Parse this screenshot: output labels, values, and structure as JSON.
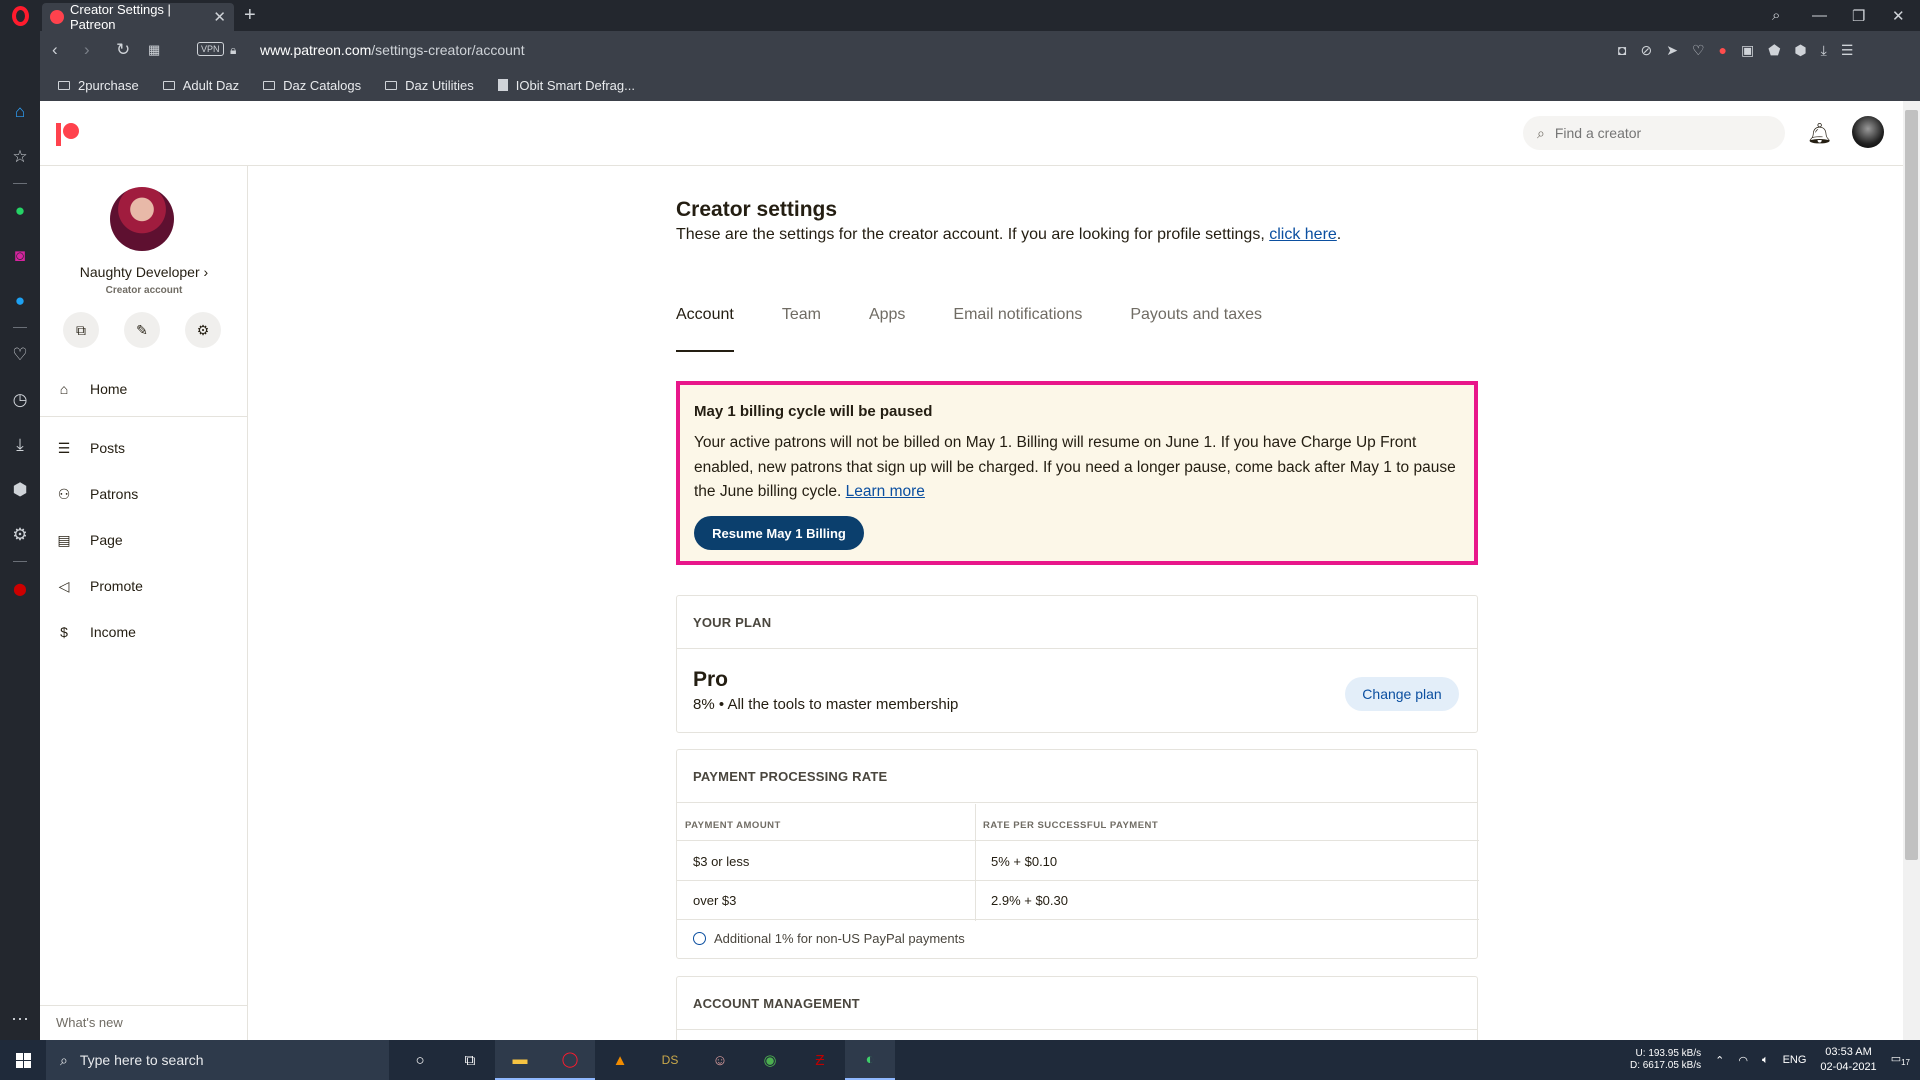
{
  "browser": {
    "tab_title": "Creator Settings | Patreon",
    "url_domain": "www.patreon.com",
    "url_path": "/settings-creator/account",
    "vpn_label": "VPN",
    "bookmarks": [
      "2purchase",
      "Adult Daz",
      "Daz Catalogs",
      "Daz Utilities",
      "IObit Smart Defrag..."
    ]
  },
  "header": {
    "search_placeholder": "Find a creator"
  },
  "sidebar": {
    "name": "Naughty Developer",
    "subtitle": "Creator account",
    "items": [
      {
        "label": "Home",
        "icon": "home-icon"
      },
      {
        "label": "Posts",
        "icon": "posts-icon"
      },
      {
        "label": "Patrons",
        "icon": "patrons-icon"
      },
      {
        "label": "Page",
        "icon": "page-icon"
      },
      {
        "label": "Promote",
        "icon": "megaphone-icon"
      },
      {
        "label": "Income",
        "icon": "dollar-icon"
      }
    ],
    "whats_new": "What's new"
  },
  "main": {
    "title": "Creator settings",
    "subtitle": "These are the settings for the creator account. If you are looking for profile settings,",
    "subtitle_link": "click here",
    "subtitle_end": ".",
    "tabs": [
      "Account",
      "Team",
      "Apps",
      "Email notifications",
      "Payouts and taxes"
    ],
    "active_tab": "Account",
    "banner": {
      "title": "May 1 billing cycle will be paused",
      "body": "Your active patrons will not be billed on May 1. Billing will resume on June 1. If you have Charge Up Front enabled, new patrons that sign up will be charged. If you need a longer pause, come back after May 1 to pause the June billing cycle.",
      "link": "Learn more",
      "button": "Resume May 1 Billing",
      "border_color": "#e8178a"
    },
    "plan": {
      "header": "YOUR PLAN",
      "name": "Pro",
      "desc": "8% • All the tools to master membership",
      "button": "Change plan"
    },
    "rate": {
      "header": "PAYMENT PROCESSING RATE",
      "col1": "PAYMENT AMOUNT",
      "col2": "RATE PER SUCCESSFUL PAYMENT",
      "rows": [
        {
          "amount": "$3 or less",
          "rate": "5% + $0.10"
        },
        {
          "amount": "over $3",
          "rate": "2.9% + $0.30"
        }
      ],
      "note": "Additional 1% for non-US PayPal payments"
    },
    "account_management": {
      "header": "ACCOUNT MANAGEMENT"
    }
  },
  "taskbar": {
    "search_placeholder": "Type here to search",
    "net_up": "193.95 kB/s",
    "net_down": "6617.05 kB/s",
    "net_up_label": "U:",
    "net_down_label": "D:",
    "lang": "ENG",
    "time": "03:53 AM",
    "date": "02-04-2021",
    "notif_count": "17"
  }
}
